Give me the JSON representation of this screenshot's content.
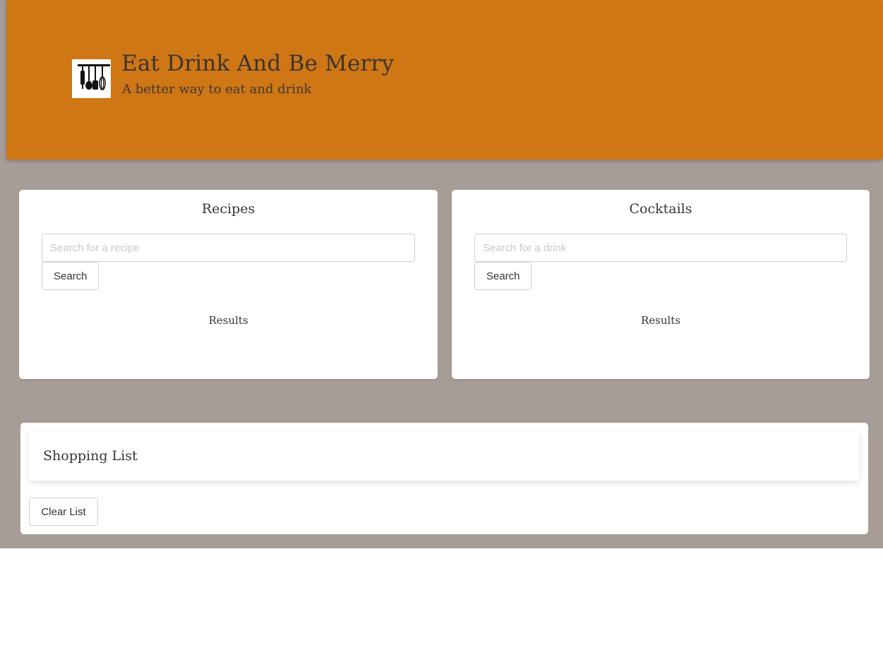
{
  "header": {
    "logo_icon": "kitchen-utensils-icon",
    "title": "Eat Drink And Be Merry",
    "subtitle": "A better way to eat and drink"
  },
  "recipes": {
    "title": "Recipes",
    "search_placeholder": "Search for a recipe",
    "search_value": "",
    "search_button": "Search",
    "results_label": "Results"
  },
  "cocktails": {
    "title": "Cocktails",
    "search_placeholder": "Search for a drink",
    "search_value": "",
    "search_button": "Search",
    "results_label": "Results"
  },
  "shopping_list": {
    "title": "Shopping List",
    "clear_button": "Clear List"
  },
  "colors": {
    "header_bg": "#cf7615",
    "page_bg": "#a69d98",
    "card_bg": "#ffffff",
    "text": "#3a3531"
  }
}
